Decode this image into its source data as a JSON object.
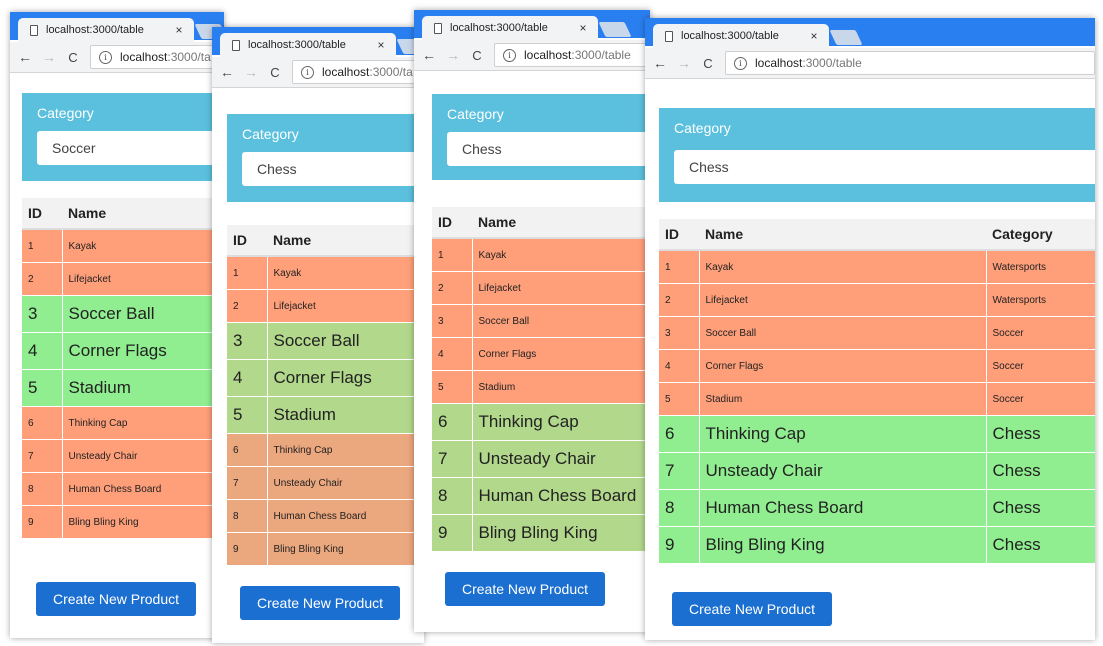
{
  "windows": [
    {
      "tab_title": "localhost:3000/table",
      "host": "localhost",
      "path": ":3000/ta",
      "category_label": "Category",
      "selected_category": "Soccer",
      "headers": [
        "ID",
        "Name"
      ],
      "rows": [
        {
          "id": "1",
          "name": "Kayak",
          "style": "small",
          "color": "#ff9f7a"
        },
        {
          "id": "2",
          "name": "Lifejacket",
          "style": "small",
          "color": "#ff9f7a"
        },
        {
          "id": "3",
          "name": "Soccer Ball",
          "style": "big",
          "color": "#90ee90"
        },
        {
          "id": "4",
          "name": "Corner Flags",
          "style": "big",
          "color": "#90ee90"
        },
        {
          "id": "5",
          "name": "Stadium",
          "style": "big",
          "color": "#90ee90"
        },
        {
          "id": "6",
          "name": "Thinking Cap",
          "style": "small",
          "color": "#ff9f7a"
        },
        {
          "id": "7",
          "name": "Unsteady Chair",
          "style": "small",
          "color": "#ff9f7a"
        },
        {
          "id": "8",
          "name": "Human Chess Board",
          "style": "small",
          "color": "#ff9f7a"
        },
        {
          "id": "9",
          "name": "Bling Bling King",
          "style": "small",
          "color": "#ff9f7a"
        }
      ],
      "button_label": "Create New Product"
    },
    {
      "tab_title": "localhost:3000/table",
      "host": "localhost",
      "path": ":3000/ta",
      "category_label": "Category",
      "selected_category": "Chess",
      "headers": [
        "ID",
        "Name"
      ],
      "rows": [
        {
          "id": "1",
          "name": "Kayak",
          "style": "small",
          "color": "#ffa07a"
        },
        {
          "id": "2",
          "name": "Lifejacket",
          "style": "small",
          "color": "#ffa07a"
        },
        {
          "id": "3",
          "name": "Soccer Ball",
          "style": "big",
          "color": "#b2d88c"
        },
        {
          "id": "4",
          "name": "Corner Flags",
          "style": "big",
          "color": "#b2d88c"
        },
        {
          "id": "5",
          "name": "Stadium",
          "style": "big",
          "color": "#b2d88c"
        },
        {
          "id": "6",
          "name": "Thinking Cap",
          "style": "small",
          "color": "#eba77e"
        },
        {
          "id": "7",
          "name": "Unsteady Chair",
          "style": "small",
          "color": "#eba77e"
        },
        {
          "id": "8",
          "name": "Human Chess Board",
          "style": "small",
          "color": "#eba77e"
        },
        {
          "id": "9",
          "name": "Bling Bling King",
          "style": "small",
          "color": "#eba77e"
        }
      ],
      "button_label": "Create New Product"
    },
    {
      "tab_title": "localhost:3000/table",
      "host": "localhost",
      "path": ":3000/table",
      "category_label": "Category",
      "selected_category": "Chess",
      "headers": [
        "ID",
        "Name"
      ],
      "rows": [
        {
          "id": "1",
          "name": "Kayak",
          "style": "small",
          "color": "#ff9f7a"
        },
        {
          "id": "2",
          "name": "Lifejacket",
          "style": "small",
          "color": "#ff9f7a"
        },
        {
          "id": "3",
          "name": "Soccer Ball",
          "style": "small",
          "color": "#ff9f7a"
        },
        {
          "id": "4",
          "name": "Corner Flags",
          "style": "small",
          "color": "#ff9f7a"
        },
        {
          "id": "5",
          "name": "Stadium",
          "style": "small",
          "color": "#ff9f7a"
        },
        {
          "id": "6",
          "name": "Thinking Cap",
          "style": "big",
          "color": "#b2d88c"
        },
        {
          "id": "7",
          "name": "Unsteady Chair",
          "style": "big",
          "color": "#b2d88c"
        },
        {
          "id": "8",
          "name": "Human Chess Board",
          "style": "big",
          "color": "#b2d88c"
        },
        {
          "id": "9",
          "name": "Bling Bling King",
          "style": "big",
          "color": "#b2d88c"
        }
      ],
      "button_label": "Create New Product"
    },
    {
      "tab_title": "localhost:3000/table",
      "host": "localhost",
      "path": ":3000/table",
      "category_label": "Category",
      "selected_category": "Chess",
      "headers": [
        "ID",
        "Name",
        "Category"
      ],
      "rows": [
        {
          "id": "1",
          "name": "Kayak",
          "category": "Watersports",
          "style": "small",
          "color": "#ff9f7a"
        },
        {
          "id": "2",
          "name": "Lifejacket",
          "category": "Watersports",
          "style": "small",
          "color": "#ff9f7a"
        },
        {
          "id": "3",
          "name": "Soccer Ball",
          "category": "Soccer",
          "style": "small",
          "color": "#ff9f7a"
        },
        {
          "id": "4",
          "name": "Corner Flags",
          "category": "Soccer",
          "style": "small",
          "color": "#ff9f7a"
        },
        {
          "id": "5",
          "name": "Stadium",
          "category": "Soccer",
          "style": "small",
          "color": "#ff9f7a"
        },
        {
          "id": "6",
          "name": "Thinking Cap",
          "category": "Chess",
          "style": "big",
          "color": "#90ee90"
        },
        {
          "id": "7",
          "name": "Unsteady Chair",
          "category": "Chess",
          "style": "big",
          "color": "#90ee90"
        },
        {
          "id": "8",
          "name": "Human Chess Board",
          "category": "Chess",
          "style": "big",
          "color": "#90ee90"
        },
        {
          "id": "9",
          "name": "Bling Bling King",
          "category": "Chess",
          "style": "big",
          "color": "#90ee90"
        }
      ],
      "button_label": "Create New Product"
    }
  ],
  "icons": {
    "back": "←",
    "forward": "→",
    "reload": "C",
    "close": "×",
    "info": "i"
  }
}
